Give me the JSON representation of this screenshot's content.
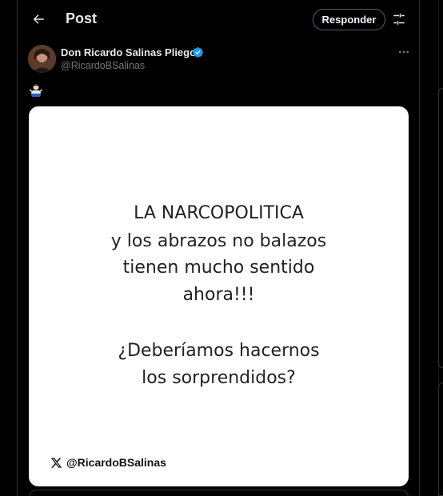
{
  "header": {
    "title": "Post",
    "reply_label": "Responder"
  },
  "author": {
    "display_name": "Don Ricardo Salinas Pliego",
    "handle": "@RicardoBSalinas",
    "verified": true
  },
  "post": {
    "emoji": "🤷🏻‍♂️",
    "image_text_lines": [
      "LA NARCOPOLITICA",
      "y los abrazos no balazos",
      "tienen mucho sentido",
      "ahora!!!",
      "¿Deberíamos hacernos",
      "los sorprendidos?"
    ],
    "watermark_handle": "@RicardoBSalinas"
  },
  "colors": {
    "background": "#000000",
    "text_primary": "#e7e9ea",
    "text_secondary": "#71767b",
    "verified_blue": "#1d9bf0",
    "border": "#2f3336"
  },
  "icons": {
    "back": "arrow-left-icon",
    "settings": "sliders-icon",
    "verified": "verified-badge-icon",
    "more": "more-horizontal-icon",
    "x_logo": "x-logo-icon"
  }
}
